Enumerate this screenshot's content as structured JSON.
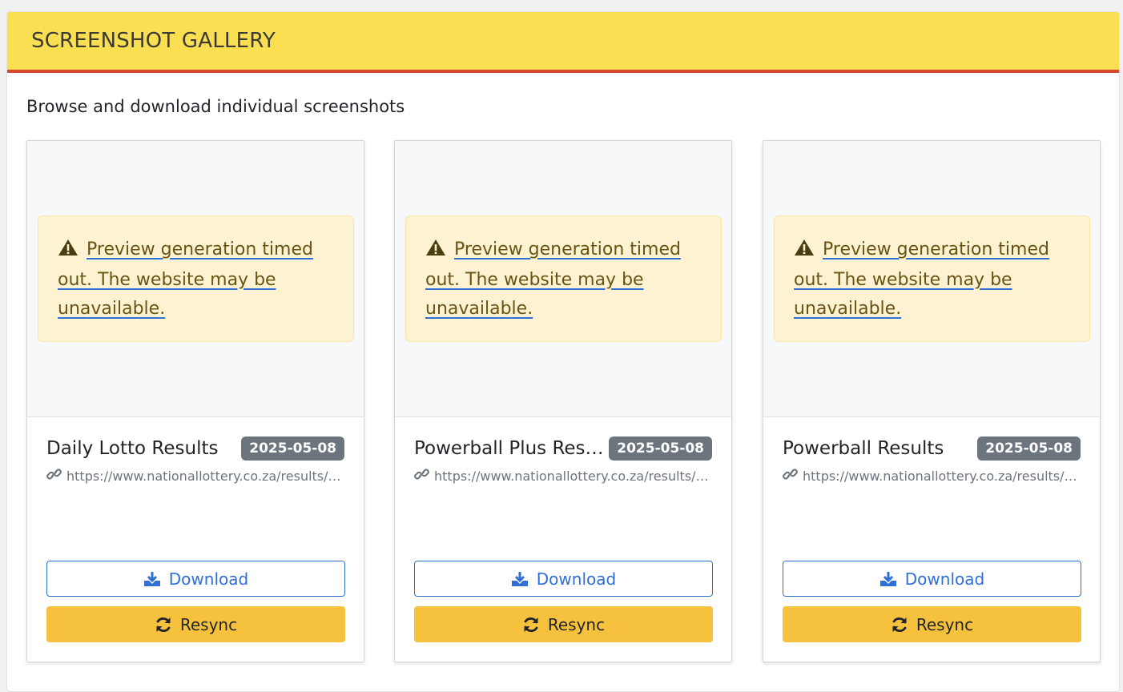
{
  "header": {
    "title": "SCREENSHOT GALLERY"
  },
  "subtitle": "Browse and download individual screenshots",
  "colors": {
    "header_bg": "#fbdf52",
    "header_border": "#d9472f",
    "accent": "#2f6fd6",
    "resync_bg": "#f6c13d",
    "badge_bg": "#6c757d",
    "alert_bg": "#fdf3d2"
  },
  "cards": [
    {
      "alert_text": "Preview generation timed out. The website may be unavailable.",
      "title": "Daily Lotto Results",
      "date": "2025-05-08",
      "url": "https://www.nationallottery.co.za/results/daily-lotto",
      "download_label": "Download",
      "resync_label": "Resync"
    },
    {
      "alert_text": "Preview generation timed out. The website may be unavailable.",
      "title": "Powerball Plus Results",
      "date": "2025-05-08",
      "url": "https://www.nationallottery.co.za/results/powerball-plus",
      "download_label": "Download",
      "resync_label": "Resync"
    },
    {
      "alert_text": "Preview generation timed out. The website may be unavailable.",
      "title": "Powerball Results",
      "date": "2025-05-08",
      "url": "https://www.nationallottery.co.za/results/powerball",
      "download_label": "Download",
      "resync_label": "Resync"
    }
  ],
  "icons": {
    "alert": "warning-icon",
    "url": "link-icon",
    "download": "download-icon",
    "resync": "sync-icon"
  }
}
